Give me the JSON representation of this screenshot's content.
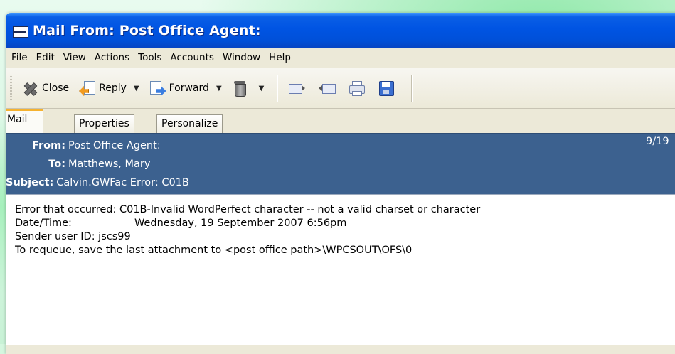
{
  "window": {
    "title": "Mail From: Post Office Agent:"
  },
  "menu": [
    {
      "label": "File"
    },
    {
      "label": "Edit"
    },
    {
      "label": "View"
    },
    {
      "label": "Actions"
    },
    {
      "label": "Tools"
    },
    {
      "label": "Accounts"
    },
    {
      "label": "Window"
    },
    {
      "label": "Help"
    }
  ],
  "toolbar": {
    "close_label": "Close",
    "reply_label": "Reply",
    "forward_label": "Forward",
    "dropdown_glyph": "▼"
  },
  "tabs": [
    {
      "label": "Mail"
    },
    {
      "label": "Properties"
    },
    {
      "label": "Personalize"
    }
  ],
  "header": {
    "from_label": "From:",
    "from_value": "Post Office Agent:",
    "to_label": "To:",
    "to_value": "Matthews, Mary",
    "subject_label": "Subject:",
    "subject_value": "Calvin.GWFac Error:  C01B",
    "date_partial": "9/19"
  },
  "message": {
    "line1": "Error that occurred: C01B-Invalid WordPerfect character -- not a valid charset or character",
    "line2_key": "Date/Time:",
    "line2_value": "Wednesday, 19 September 2007 6:56pm",
    "line3": "Sender user ID: jscs99",
    "line4": "To requeue, save the last attachment to <post office path>\\WPCSOUT\\OFS\\0"
  },
  "colors": {
    "titlebar": "#0054e3",
    "header_bg": "#3c618f",
    "tab_accent": "#f5b230"
  }
}
